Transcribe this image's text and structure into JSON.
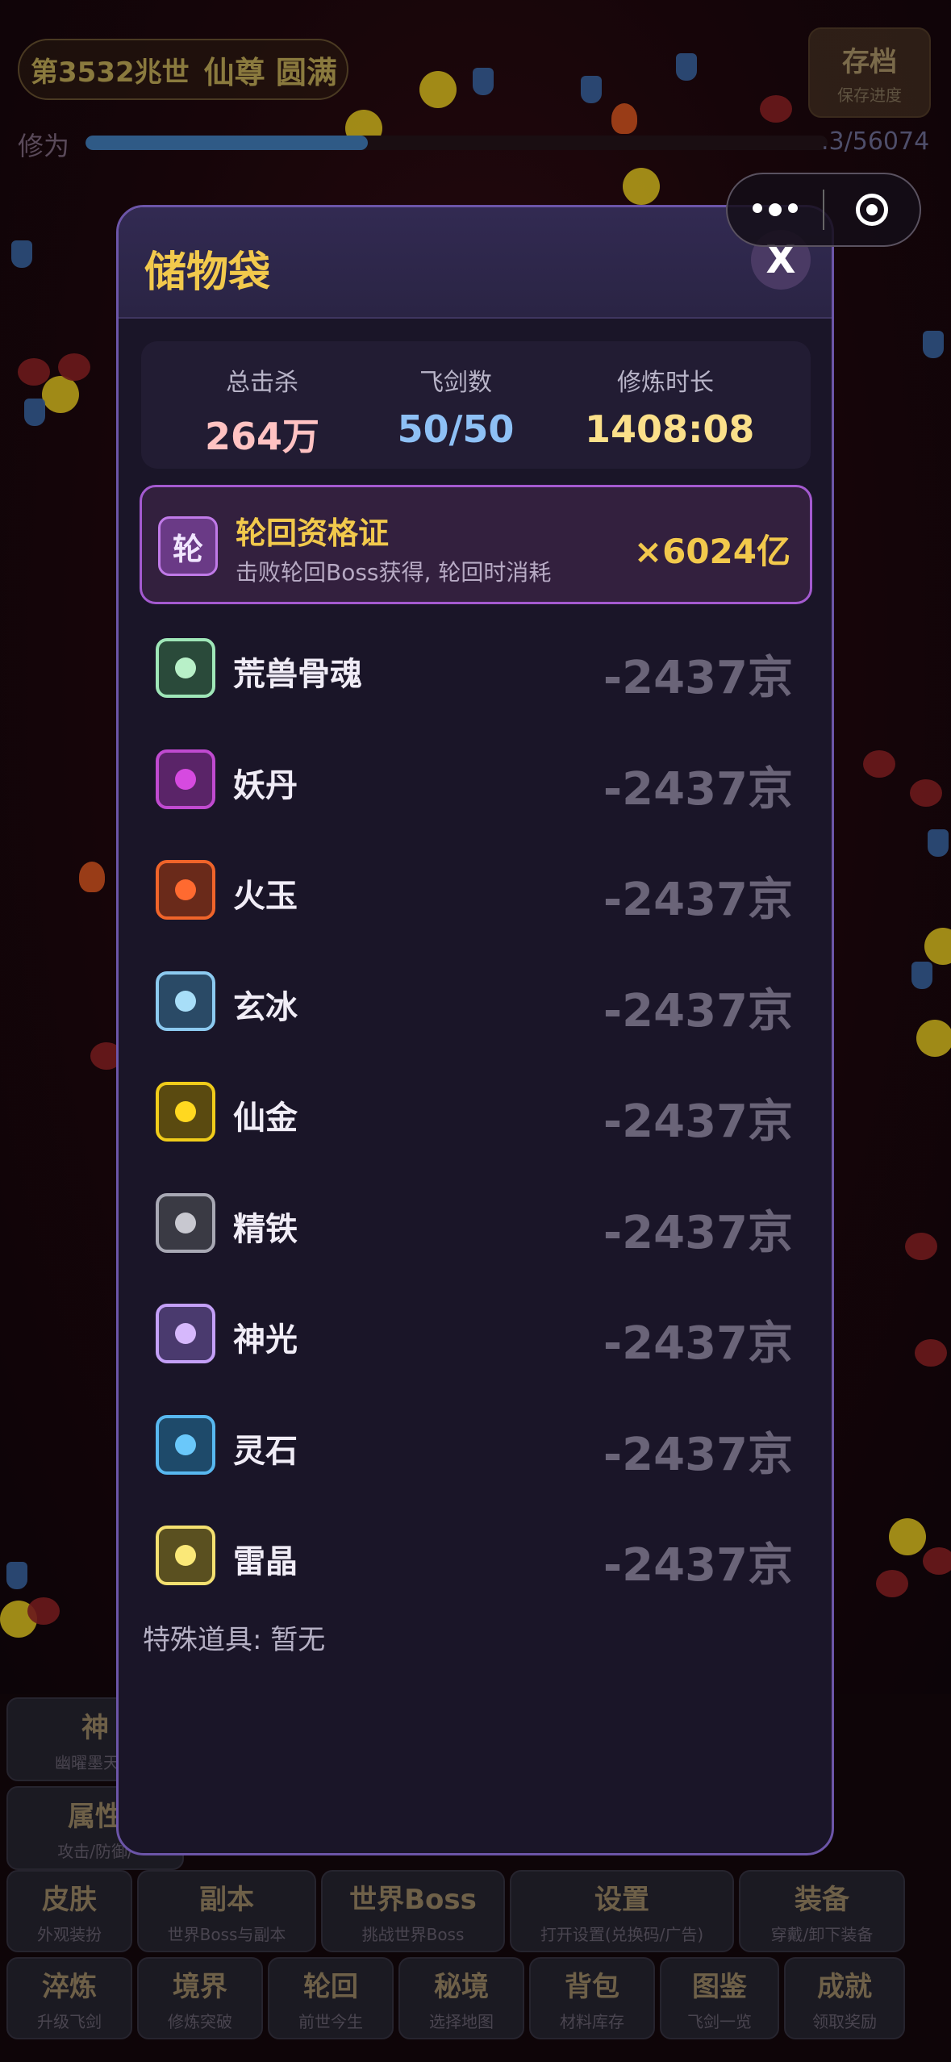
{
  "hud": {
    "title": "第3532兆世",
    "realm": "仙尊 圆满",
    "save_label": "存档",
    "save_sub": "保存进度",
    "xiuwei_label": "修为",
    "xiuwei_value": ".3/56074",
    "xiuwei_progress": 0.38
  },
  "modal": {
    "title": "储物袋",
    "close_label": "X",
    "stats": {
      "kills_label": "总击杀",
      "kills_value": "264万",
      "swords_label": "飞剑数",
      "swords_value": "50/50",
      "time_label": "修炼时长",
      "time_value": "1408:08"
    },
    "special_item": {
      "icon_char": "轮",
      "name": "轮回资格证",
      "desc": "击败轮回Boss获得, 轮回时消耗",
      "count": "×6024亿"
    },
    "materials": [
      {
        "name": "荒兽骨魂",
        "count": "-2437京",
        "border": "#9fe6b8",
        "fill": "#2a4a3a",
        "dot": "#b8f0c8"
      },
      {
        "name": "妖丹",
        "count": "-2437京",
        "border": "#c04ad0",
        "fill": "#5a2468",
        "dot": "#d64ae0"
      },
      {
        "name": "火玉",
        "count": "-2437京",
        "border": "#f0642a",
        "fill": "#6a2a1a",
        "dot": "#ff6a30"
      },
      {
        "name": "玄冰",
        "count": "-2437京",
        "border": "#8ccaf0",
        "fill": "#2a4a66",
        "dot": "#a8def8"
      },
      {
        "name": "仙金",
        "count": "-2437京",
        "border": "#f0cc1a",
        "fill": "#5a4a10",
        "dot": "#ffd820"
      },
      {
        "name": "精铁",
        "count": "-2437京",
        "border": "#a8a8b4",
        "fill": "#3a3a44",
        "dot": "#c8c8d0"
      },
      {
        "name": "神光",
        "count": "-2437京",
        "border": "#c4a0f8",
        "fill": "#4a3a6e",
        "dot": "#d6b8fc"
      },
      {
        "name": "灵石",
        "count": "-2437京",
        "border": "#58b8f0",
        "fill": "#1e4a6a",
        "dot": "#6ac8fa"
      },
      {
        "name": "雷晶",
        "count": "-2437京",
        "border": "#f4e070",
        "fill": "#5a5020",
        "dot": "#fae878"
      }
    ],
    "special_note": "特殊道具: 暂无"
  },
  "nav": {
    "row0": [
      {
        "label": "神",
        "sub": "幽曜墨天帝"
      },
      {
        "label": "属性",
        "sub": "攻击/防御/"
      }
    ],
    "row1": [
      {
        "label": "皮肤",
        "sub": "外观装扮"
      },
      {
        "label": "副本",
        "sub": "世界Boss与副本"
      },
      {
        "label": "世界Boss",
        "sub": "挑战世界Boss"
      },
      {
        "label": "设置",
        "sub": "打开设置(兑换码/广告)"
      },
      {
        "label": "装备",
        "sub": "穿戴/卸下装备"
      }
    ],
    "row2": [
      {
        "label": "淬炼",
        "sub": "升级飞剑"
      },
      {
        "label": "境界",
        "sub": "修炼突破"
      },
      {
        "label": "轮回",
        "sub": "前世今生"
      },
      {
        "label": "秘境",
        "sub": "选择地图"
      },
      {
        "label": "背包",
        "sub": "材料库存"
      },
      {
        "label": "图鉴",
        "sub": "飞剑一览"
      },
      {
        "label": "成就",
        "sub": "领取奖励"
      }
    ]
  }
}
